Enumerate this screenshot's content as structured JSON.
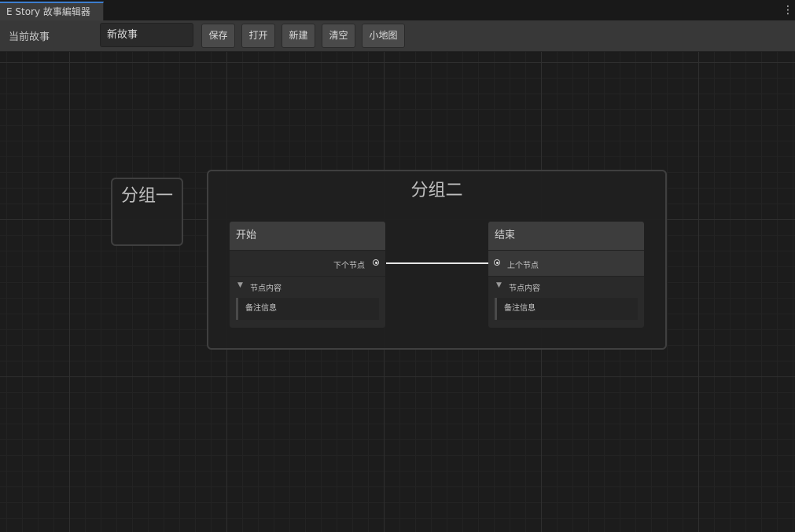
{
  "window": {
    "tab_title": "E Story 故事編辑器",
    "menu_icon": "vertical-ellipsis-icon"
  },
  "toolbar": {
    "current_story_label": "当前故事",
    "story_name_value": "新故事",
    "buttons": [
      "保存",
      "打开",
      "新建",
      "清空",
      "小地图"
    ]
  },
  "graph": {
    "groups": [
      {
        "title": "分组一"
      },
      {
        "title": "分组二"
      }
    ],
    "nodes": [
      {
        "title": "开始",
        "output_port": "下个节点",
        "foldout_label": "节点内容",
        "note": "备注信息"
      },
      {
        "title": "结束",
        "input_port": "上个节点",
        "foldout_label": "节点内容",
        "note": "备注信息"
      }
    ],
    "edge": {
      "from": "下个节点",
      "to": "上个节点"
    }
  },
  "colors": {
    "accent": "#3d7ecf",
    "canvas_bg": "#1c1c1c",
    "edge": "#e6e6e6"
  }
}
